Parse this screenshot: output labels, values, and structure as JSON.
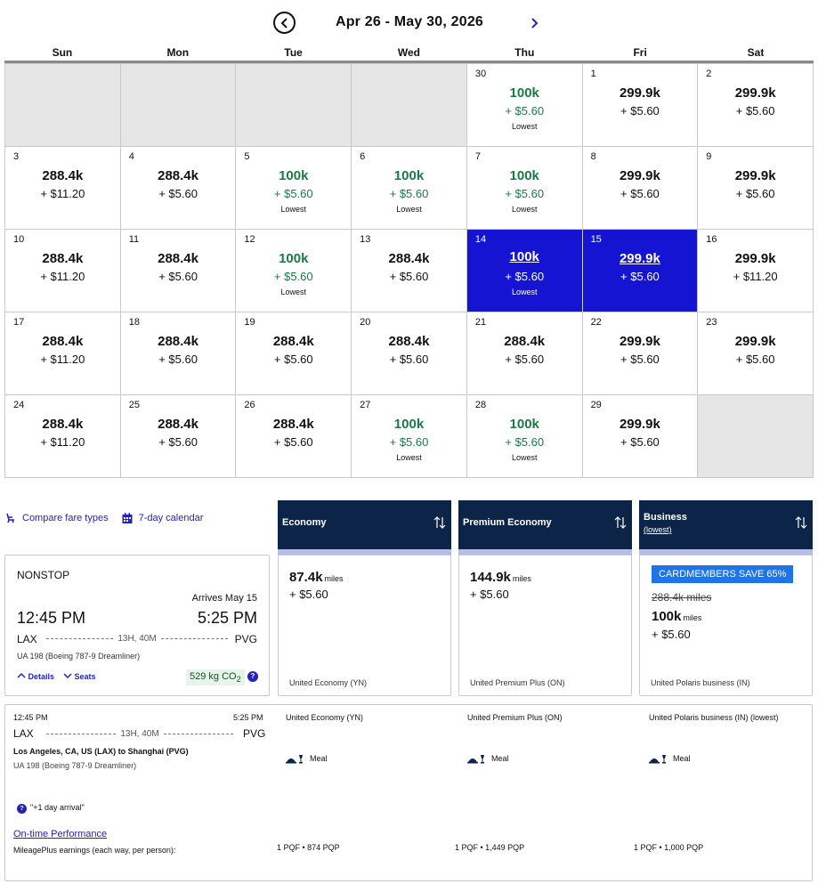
{
  "header": {
    "range": "Apr 26 - May 30, 2026"
  },
  "weekdays": [
    "Sun",
    "Mon",
    "Tue",
    "Wed",
    "Thu",
    "Fri",
    "Sat"
  ],
  "calendar": [
    {
      "day": "",
      "miles": "",
      "fee": "",
      "tag": ""
    },
    {
      "day": "",
      "miles": "",
      "fee": "",
      "tag": ""
    },
    {
      "day": "",
      "miles": "",
      "fee": "",
      "tag": ""
    },
    {
      "day": "",
      "miles": "",
      "fee": "",
      "tag": ""
    },
    {
      "day": "30",
      "miles": "100k",
      "fee": "+ $5.60",
      "tag": "Lowest"
    },
    {
      "day": "1",
      "miles": "299.9k",
      "fee": "+ $5.60",
      "tag": ""
    },
    {
      "day": "2",
      "miles": "299.9k",
      "fee": "+ $5.60",
      "tag": ""
    },
    {
      "day": "3",
      "miles": "288.4k",
      "fee": "+ $11.20",
      "tag": ""
    },
    {
      "day": "4",
      "miles": "288.4k",
      "fee": "+ $5.60",
      "tag": ""
    },
    {
      "day": "5",
      "miles": "100k",
      "fee": "+ $5.60",
      "tag": "Lowest"
    },
    {
      "day": "6",
      "miles": "100k",
      "fee": "+ $5.60",
      "tag": "Lowest"
    },
    {
      "day": "7",
      "miles": "100k",
      "fee": "+ $5.60",
      "tag": "Lowest"
    },
    {
      "day": "8",
      "miles": "299.9k",
      "fee": "+ $5.60",
      "tag": ""
    },
    {
      "day": "9",
      "miles": "299.9k",
      "fee": "+ $5.60",
      "tag": ""
    },
    {
      "day": "10",
      "miles": "288.4k",
      "fee": "+ $11.20",
      "tag": ""
    },
    {
      "day": "11",
      "miles": "288.4k",
      "fee": "+ $5.60",
      "tag": ""
    },
    {
      "day": "12",
      "miles": "100k",
      "fee": "+ $5.60",
      "tag": "Lowest"
    },
    {
      "day": "13",
      "miles": "288.4k",
      "fee": "+ $5.60",
      "tag": ""
    },
    {
      "day": "14",
      "miles": "100k",
      "fee": "+ $5.60",
      "tag": "Lowest",
      "selected": true
    },
    {
      "day": "15",
      "miles": "299.9k",
      "fee": "+ $5.60",
      "tag": "",
      "selected": true
    },
    {
      "day": "16",
      "miles": "299.9k",
      "fee": "+ $11.20",
      "tag": ""
    },
    {
      "day": "17",
      "miles": "288.4k",
      "fee": "+ $11.20",
      "tag": ""
    },
    {
      "day": "18",
      "miles": "288.4k",
      "fee": "+ $5.60",
      "tag": ""
    },
    {
      "day": "19",
      "miles": "288.4k",
      "fee": "+ $5.60",
      "tag": ""
    },
    {
      "day": "20",
      "miles": "288.4k",
      "fee": "+ $5.60",
      "tag": ""
    },
    {
      "day": "21",
      "miles": "288.4k",
      "fee": "+ $5.60",
      "tag": ""
    },
    {
      "day": "22",
      "miles": "299.9k",
      "fee": "+ $5.60",
      "tag": ""
    },
    {
      "day": "23",
      "miles": "299.9k",
      "fee": "+ $5.60",
      "tag": ""
    },
    {
      "day": "24",
      "miles": "288.4k",
      "fee": "+ $11.20",
      "tag": ""
    },
    {
      "day": "25",
      "miles": "288.4k",
      "fee": "+ $5.60",
      "tag": ""
    },
    {
      "day": "26",
      "miles": "288.4k",
      "fee": "+ $5.60",
      "tag": ""
    },
    {
      "day": "27",
      "miles": "100k",
      "fee": "+ $5.60",
      "tag": "Lowest"
    },
    {
      "day": "28",
      "miles": "100k",
      "fee": "+ $5.60",
      "tag": "Lowest"
    },
    {
      "day": "29",
      "miles": "299.9k",
      "fee": "+ $5.60",
      "tag": ""
    },
    {
      "day": "",
      "miles": "",
      "fee": "",
      "tag": ""
    }
  ],
  "tools": {
    "compare": "Compare fare types",
    "calendar7": "7-day calendar"
  },
  "fare_columns": {
    "economy": {
      "title": "Economy"
    },
    "premium": {
      "title": "Premium Economy"
    },
    "business": {
      "title": "Business",
      "sub": "(lowest)"
    }
  },
  "flight": {
    "nonstop": "NONSTOP",
    "arrives": "Arrives May 15",
    "dep_time": "12:45 PM",
    "arr_time": "5:25 PM",
    "origin": "LAX",
    "dest": "PVG",
    "duration": "13H, 40M",
    "flight_no": "UA 198 (Boeing 787-9 Dreamliner)",
    "details_link": "Details",
    "seats_link": "Seats",
    "co2": "529 kg CO",
    "co2_sub": "2",
    "info": "?"
  },
  "fares": {
    "economy": {
      "miles": "87.4k",
      "unit": "miles",
      "fee": "+ $5.60",
      "name": "United Economy (YN)"
    },
    "premium": {
      "miles": "144.9k",
      "unit": "miles",
      "fee": "+ $5.60",
      "name": "United Premium Plus (ON)"
    },
    "business": {
      "promo": "CARDMEMBERS SAVE 65%",
      "original": "288.4k miles",
      "miles": "100k",
      "unit": "miles",
      "fee": "+ $5.60",
      "name": "United Polaris business (IN)"
    }
  },
  "details": {
    "dep_time": "12:45 PM",
    "arr_time": "5:25 PM",
    "origin": "LAX",
    "dest": "PVG",
    "duration": "13H, 40M",
    "route": "Los Angeles, CA, US (LAX) to Shanghai (PVG)",
    "flight_no": "UA 198 (Boeing 787-9 Dreamliner)",
    "note": "\"+1 day arrival\"",
    "ontime": "On-time Performance",
    "earnings_label": "MileagePlus earnings (each way, per person):",
    "columns": [
      {
        "fare": "United Economy (YN)",
        "meal": "Meal",
        "pqp": "1 PQF • 874 PQP"
      },
      {
        "fare": "United Premium Plus (ON)",
        "meal": "Meal",
        "pqp": "1 PQF • 1,449 PQP"
      },
      {
        "fare": "United Polaris business (IN) (lowest)",
        "meal": "Meal",
        "pqp": "1 PQF • 1,000 PQP"
      }
    ]
  },
  "colors": {
    "navy": "#0b2447",
    "selected": "#1414d2",
    "lowest": "#1a7a44",
    "link": "#2323b8",
    "promo": "#1f74e8"
  }
}
